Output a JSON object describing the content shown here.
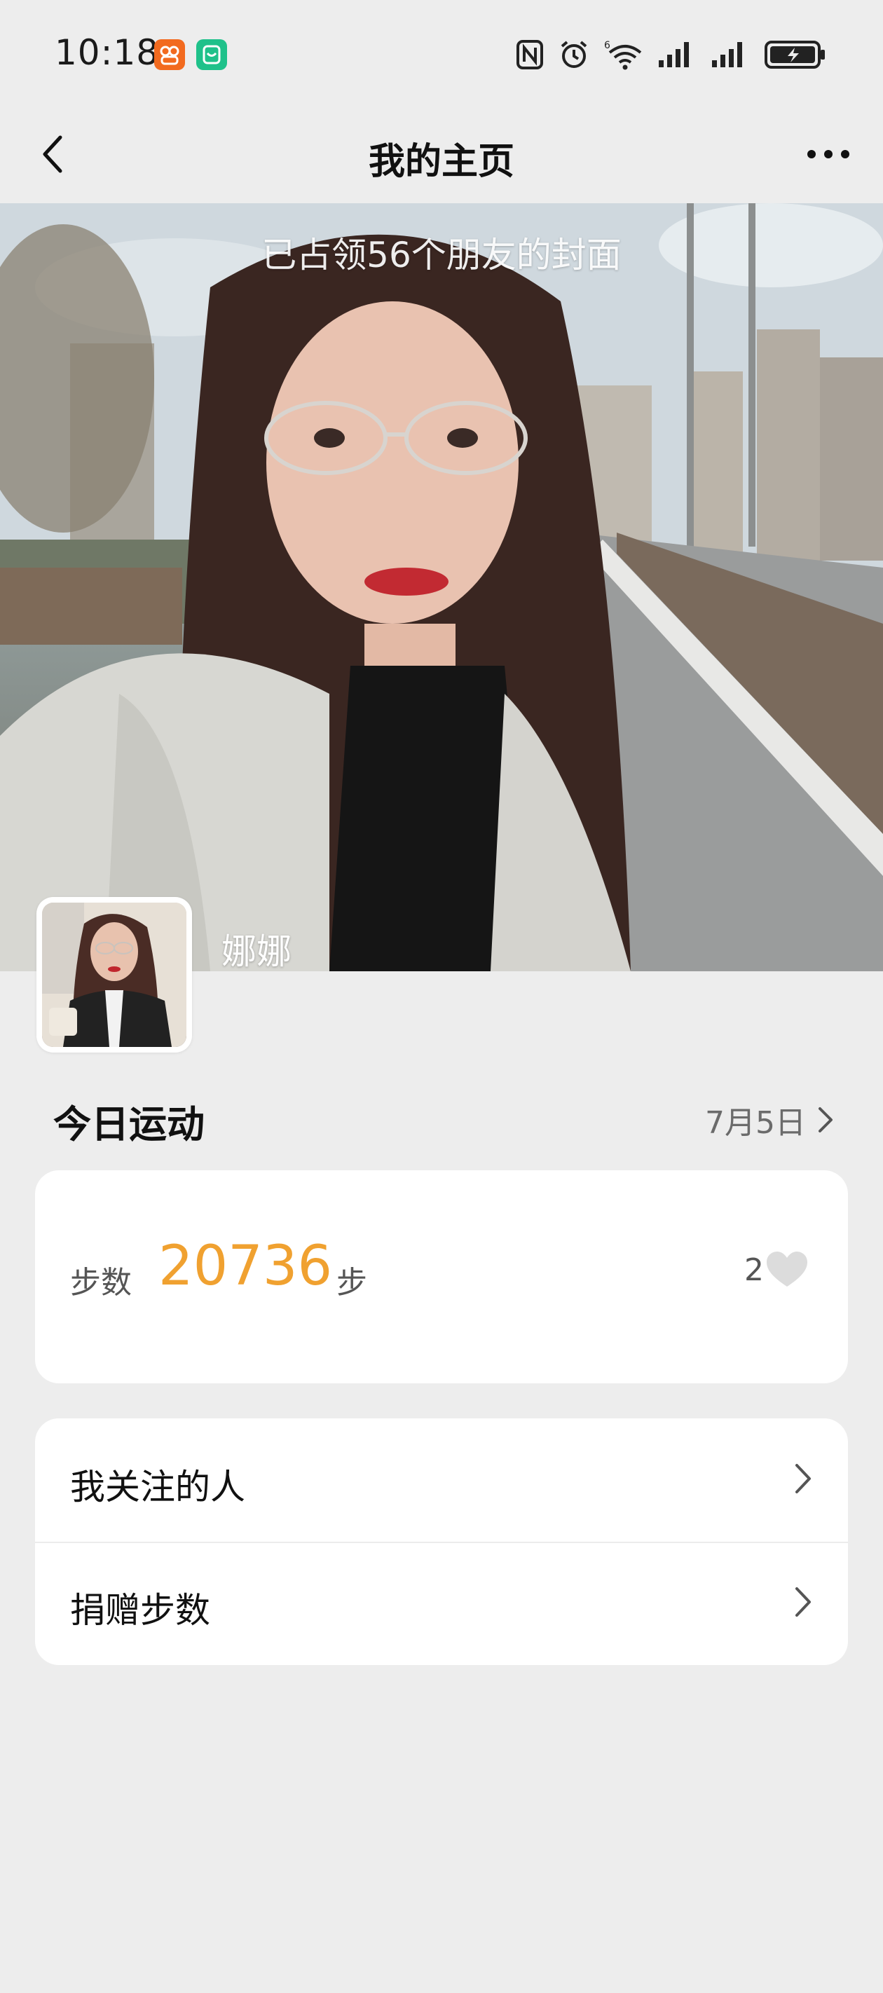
{
  "status_bar": {
    "time": "10:18",
    "icons": [
      "app-badge-orange",
      "app-badge-green",
      "nfc-icon",
      "alarm-icon",
      "wifi-icon",
      "signal-icon",
      "signal-icon",
      "battery-charging-icon"
    ]
  },
  "nav": {
    "title": "我的主页"
  },
  "cover": {
    "caption": "已占领56个朋友的封面",
    "nickname": "娜娜"
  },
  "today": {
    "title": "今日运动",
    "date": "7月5日"
  },
  "steps": {
    "label": "步数",
    "value": "20736",
    "unit": "步",
    "likes": "2"
  },
  "menu": {
    "items": [
      {
        "label": "我关注的人"
      },
      {
        "label": "捐赠步数"
      }
    ]
  },
  "colors": {
    "background": "#ededed",
    "accent": "#f0a130",
    "card": "#ffffff"
  }
}
